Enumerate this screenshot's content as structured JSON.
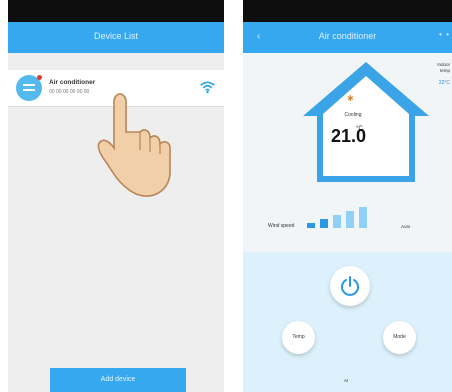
{
  "left_screen": {
    "title": "Device List",
    "device": {
      "name": "Air conditioner",
      "subtitle": "00 00 00 00 00 00"
    },
    "add_button": "Add device"
  },
  "right_screen": {
    "title": "Air conditioner",
    "mode_label": "Cooling",
    "temperature": "21.0",
    "temp_unit": "°C",
    "side_text": [
      "Indoor",
      "temp"
    ],
    "side_link": "22°C",
    "wind_low_label": "Wind speed",
    "wind_high_label": "Auto",
    "temp_button": "Temp",
    "mode_button": "Mode",
    "bottom_label": "AI",
    "wind_speed_level": 0.4
  },
  "colors": {
    "navbar": "#36a8ef",
    "accent": "#36a8ef",
    "status_bar": "#0e0e0e"
  }
}
